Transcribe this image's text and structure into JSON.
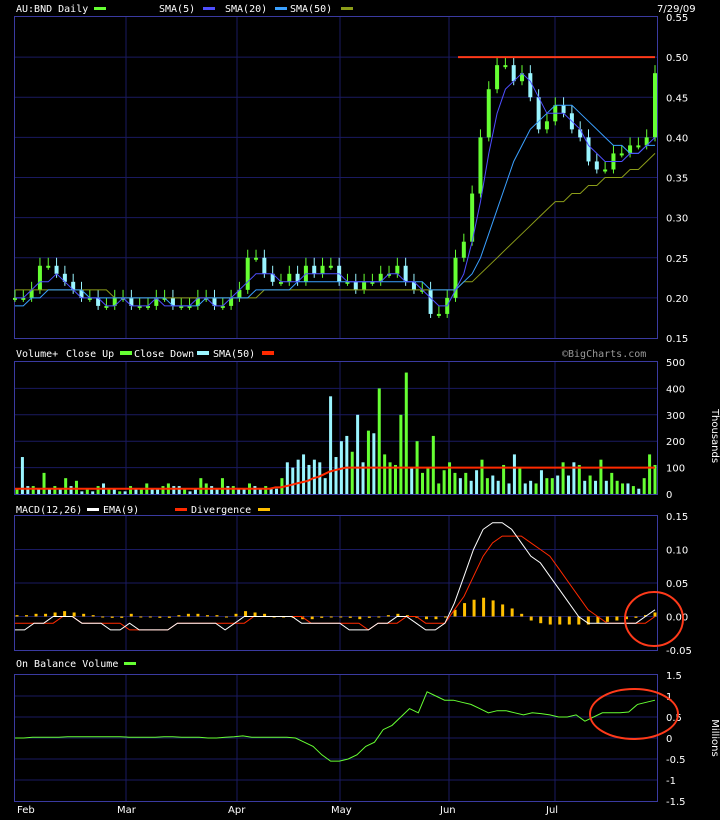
{
  "chart_data": [
    {
      "type": "line",
      "panel": "price",
      "title": "AU:BND Daily",
      "date": "7/29/09",
      "legend": [
        {
          "label": "SMA(5)",
          "color": "#4f4fff"
        },
        {
          "label": "SMA(20)",
          "color": "#3aa0ff"
        },
        {
          "label": "SMA(50)",
          "color": "#8c9d19"
        }
      ],
      "title_swatch_color": "#66ff33",
      "ylim": [
        0.15,
        0.55
      ],
      "yticks": [
        "0.15",
        "0.20",
        "0.25",
        "0.30",
        "0.35",
        "0.40",
        "0.45",
        "0.50",
        "0.55"
      ],
      "xlabels": [
        "Feb",
        "Mar",
        "Apr",
        "May",
        "Jun",
        "Jul"
      ],
      "resistance_level": 0.5,
      "price_points": [
        0.2,
        0.2,
        0.21,
        0.24,
        0.24,
        0.23,
        0.22,
        0.21,
        0.2,
        0.2,
        0.19,
        0.19,
        0.2,
        0.2,
        0.19,
        0.19,
        0.19,
        0.2,
        0.2,
        0.19,
        0.19,
        0.19,
        0.2,
        0.2,
        0.19,
        0.19,
        0.2,
        0.21,
        0.25,
        0.25,
        0.23,
        0.22,
        0.22,
        0.23,
        0.22,
        0.24,
        0.23,
        0.24,
        0.24,
        0.22,
        0.22,
        0.21,
        0.22,
        0.22,
        0.23,
        0.23,
        0.24,
        0.22,
        0.21,
        0.21,
        0.18,
        0.18,
        0.2,
        0.25,
        0.27,
        0.33,
        0.4,
        0.46,
        0.49,
        0.49,
        0.47,
        0.48,
        0.45,
        0.41,
        0.42,
        0.44,
        0.43,
        0.41,
        0.4,
        0.37,
        0.36,
        0.36,
        0.38,
        0.38,
        0.39,
        0.39,
        0.4,
        0.48
      ],
      "sma5_points": [
        0.2,
        0.2,
        0.21,
        0.22,
        0.22,
        0.23,
        0.22,
        0.21,
        0.2,
        0.2,
        0.2,
        0.19,
        0.19,
        0.2,
        0.19,
        0.19,
        0.19,
        0.2,
        0.19,
        0.19,
        0.19,
        0.19,
        0.2,
        0.2,
        0.19,
        0.19,
        0.2,
        0.21,
        0.22,
        0.23,
        0.23,
        0.23,
        0.22,
        0.22,
        0.22,
        0.23,
        0.23,
        0.23,
        0.23,
        0.23,
        0.22,
        0.22,
        0.22,
        0.22,
        0.22,
        0.23,
        0.23,
        0.22,
        0.22,
        0.21,
        0.2,
        0.19,
        0.19,
        0.21,
        0.23,
        0.27,
        0.32,
        0.38,
        0.43,
        0.46,
        0.47,
        0.48,
        0.47,
        0.45,
        0.43,
        0.43,
        0.43,
        0.42,
        0.41,
        0.39,
        0.38,
        0.37,
        0.37,
        0.37,
        0.38,
        0.38,
        0.39,
        0.4
      ],
      "sma20_points": [
        0.19,
        0.19,
        0.2,
        0.2,
        0.21,
        0.21,
        0.21,
        0.21,
        0.21,
        0.2,
        0.2,
        0.2,
        0.2,
        0.2,
        0.2,
        0.2,
        0.2,
        0.2,
        0.2,
        0.19,
        0.19,
        0.19,
        0.19,
        0.2,
        0.2,
        0.2,
        0.2,
        0.2,
        0.2,
        0.21,
        0.21,
        0.21,
        0.21,
        0.21,
        0.22,
        0.22,
        0.22,
        0.22,
        0.22,
        0.22,
        0.22,
        0.22,
        0.22,
        0.22,
        0.22,
        0.22,
        0.22,
        0.22,
        0.22,
        0.22,
        0.21,
        0.21,
        0.21,
        0.21,
        0.22,
        0.23,
        0.25,
        0.28,
        0.31,
        0.34,
        0.37,
        0.39,
        0.41,
        0.42,
        0.43,
        0.44,
        0.44,
        0.44,
        0.43,
        0.42,
        0.41,
        0.4,
        0.39,
        0.39,
        0.38,
        0.38,
        0.39,
        0.39
      ],
      "sma50_points": [
        0.21,
        0.21,
        0.21,
        0.21,
        0.21,
        0.21,
        0.21,
        0.21,
        0.21,
        0.21,
        0.21,
        0.21,
        0.2,
        0.2,
        0.2,
        0.2,
        0.2,
        0.2,
        0.2,
        0.2,
        0.2,
        0.2,
        0.2,
        0.2,
        0.2,
        0.2,
        0.2,
        0.2,
        0.2,
        0.2,
        0.21,
        0.21,
        0.21,
        0.21,
        0.21,
        0.21,
        0.21,
        0.21,
        0.21,
        0.21,
        0.21,
        0.21,
        0.21,
        0.21,
        0.21,
        0.21,
        0.21,
        0.21,
        0.21,
        0.21,
        0.21,
        0.21,
        0.21,
        0.21,
        0.22,
        0.22,
        0.23,
        0.24,
        0.25,
        0.26,
        0.27,
        0.28,
        0.29,
        0.3,
        0.31,
        0.32,
        0.32,
        0.33,
        0.33,
        0.34,
        0.34,
        0.35,
        0.35,
        0.35,
        0.36,
        0.36,
        0.37,
        0.38
      ]
    },
    {
      "type": "bar",
      "panel": "volume",
      "legend_title": "Volume+",
      "legend": [
        {
          "label": "Close Up",
          "color": "#66ff33"
        },
        {
          "label": "Close Down",
          "color": "#9af5ff"
        },
        {
          "label": "SMA(50)",
          "color": "#ff2a00"
        }
      ],
      "watermark": "©BigCharts.com",
      "ylabel": "Thousands",
      "ylim": [
        0,
        500
      ],
      "yticks": [
        "0",
        "100",
        "200",
        "300",
        "400",
        "500"
      ],
      "volumes": [
        20,
        140,
        30,
        30,
        20,
        80,
        20,
        30,
        20,
        60,
        30,
        50,
        10,
        20,
        10,
        30,
        40,
        20,
        20,
        10,
        10,
        30,
        20,
        20,
        40,
        20,
        20,
        30,
        40,
        30,
        30,
        20,
        10,
        20,
        60,
        40,
        30,
        20,
        60,
        30,
        30,
        20,
        20,
        40,
        30,
        20,
        30,
        20,
        20,
        60,
        120,
        100,
        130,
        150,
        110,
        130,
        120,
        60,
        370,
        140,
        200,
        220,
        160,
        300,
        120,
        240,
        230,
        400,
        150,
        120,
        110,
        300,
        460,
        100,
        200,
        80,
        100,
        220,
        40,
        90,
        120,
        80,
        60,
        80,
        50,
        90,
        130,
        60,
        70,
        50,
        110,
        40,
        150,
        100,
        40,
        50,
        40,
        90,
        60,
        60,
        70,
        120,
        70,
        120,
        110,
        50,
        70,
        50,
        130,
        50,
        80,
        50,
        40,
        40,
        30,
        20,
        60,
        150,
        110
      ],
      "up_flags": [
        1,
        0,
        0,
        1,
        0,
        1,
        0,
        1,
        0,
        1,
        0,
        1,
        0,
        1,
        0,
        1,
        0,
        1,
        0,
        1,
        0,
        1,
        0,
        1,
        1,
        0,
        0,
        1,
        1,
        0,
        0,
        1,
        0,
        0,
        1,
        1,
        0,
        0,
        1,
        0,
        1,
        0,
        0,
        1,
        0,
        0,
        1,
        0,
        0,
        1,
        0,
        0,
        0,
        0,
        0,
        0,
        0,
        0,
        0,
        0,
        0,
        0,
        1,
        0,
        0,
        1,
        0,
        1,
        1,
        1,
        1,
        1,
        1,
        0,
        1,
        1,
        1,
        1,
        1,
        1,
        1,
        1,
        0,
        1,
        0,
        0,
        1,
        1,
        0,
        0,
        1,
        0,
        0,
        1,
        0,
        0,
        1,
        0,
        1,
        1,
        0,
        1,
        0,
        0,
        1,
        0,
        1,
        0,
        1,
        0,
        1,
        1,
        1,
        0,
        1,
        0,
        1,
        1,
        1
      ],
      "sma50": [
        20,
        20,
        20,
        20,
        20,
        20,
        20,
        20,
        20,
        20,
        20,
        20,
        20,
        20,
        20,
        20,
        20,
        20,
        20,
        20,
        20,
        20,
        20,
        20,
        20,
        20,
        20,
        20,
        20,
        20,
        20,
        20,
        20,
        20,
        20,
        20,
        20,
        20,
        20,
        20,
        20,
        20,
        20,
        20,
        20,
        20,
        20,
        20,
        25,
        25,
        30,
        35,
        40,
        45,
        50,
        60,
        65,
        75,
        85,
        90,
        95,
        100,
        100,
        100,
        100,
        100,
        100,
        100,
        100,
        100,
        100,
        100,
        100,
        100,
        100,
        100,
        100,
        100,
        100,
        100,
        100,
        100,
        100,
        100,
        100,
        100,
        100,
        100,
        100,
        100,
        100,
        100,
        100,
        100,
        100,
        100,
        100,
        100,
        100,
        100,
        100,
        100,
        100,
        100,
        100,
        100,
        100,
        100,
        100,
        100,
        100,
        100,
        100,
        100,
        100,
        100,
        100,
        100,
        100
      ]
    },
    {
      "type": "line",
      "panel": "macd",
      "legend": [
        {
          "label": "MACD(12,26)",
          "color": "#ffffff"
        },
        {
          "label": "EMA(9)",
          "color": "#ff2a00"
        },
        {
          "label": "Divergence",
          "color": "#ffbf00"
        }
      ],
      "ylim": [
        -0.05,
        0.15
      ],
      "yticks": [
        "-0.05",
        "0.00",
        "0.05",
        "0.10",
        "0.15"
      ],
      "macd_points": [
        -0.02,
        -0.02,
        -0.01,
        -0.01,
        0.0,
        0.0,
        0.0,
        -0.01,
        -0.01,
        -0.01,
        -0.02,
        -0.02,
        -0.01,
        -0.02,
        -0.02,
        -0.02,
        -0.02,
        -0.01,
        -0.01,
        -0.01,
        -0.01,
        -0.01,
        -0.02,
        -0.01,
        0.0,
        0.0,
        0.0,
        0.0,
        0.0,
        0.0,
        -0.01,
        -0.01,
        -0.01,
        -0.01,
        -0.01,
        -0.02,
        -0.02,
        -0.02,
        -0.01,
        -0.01,
        0.0,
        0.0,
        -0.01,
        -0.02,
        -0.02,
        -0.01,
        0.02,
        0.06,
        0.1,
        0.13,
        0.14,
        0.14,
        0.13,
        0.11,
        0.09,
        0.08,
        0.06,
        0.04,
        0.02,
        0.0,
        -0.01,
        -0.01,
        -0.01,
        -0.01,
        -0.01,
        -0.01,
        0.0,
        0.01
      ],
      "ema_points": [
        -0.01,
        -0.01,
        -0.01,
        -0.01,
        -0.01,
        0.0,
        0.0,
        -0.01,
        -0.01,
        -0.01,
        -0.01,
        -0.01,
        -0.02,
        -0.02,
        -0.02,
        -0.02,
        -0.02,
        -0.01,
        -0.01,
        -0.01,
        -0.01,
        -0.01,
        -0.01,
        -0.01,
        -0.01,
        0.0,
        0.0,
        0.0,
        0.0,
        0.0,
        0.0,
        -0.01,
        -0.01,
        -0.01,
        -0.01,
        -0.01,
        -0.01,
        -0.02,
        -0.01,
        -0.01,
        -0.01,
        0.0,
        0.0,
        -0.01,
        -0.01,
        -0.01,
        0.01,
        0.03,
        0.06,
        0.09,
        0.11,
        0.12,
        0.12,
        0.12,
        0.11,
        0.1,
        0.09,
        0.07,
        0.05,
        0.03,
        0.01,
        0.0,
        -0.01,
        -0.01,
        -0.01,
        -0.01,
        -0.01,
        0.0
      ],
      "divergence_points": [
        0.002,
        0.002,
        0.004,
        0.004,
        0.006,
        0.008,
        0.006,
        0.004,
        0.002,
        0.0,
        -0.002,
        -0.002,
        0.004,
        0.0,
        0.0,
        -0.002,
        -0.002,
        0.002,
        0.004,
        0.004,
        0.002,
        0.002,
        0.0,
        0.004,
        0.008,
        0.006,
        0.004,
        0.0,
        0.0,
        -0.002,
        -0.004,
        -0.004,
        -0.002,
        0.0,
        0.0,
        -0.002,
        -0.004,
        -0.002,
        0.0,
        0.002,
        0.004,
        0.002,
        -0.002,
        -0.004,
        -0.004,
        0.0,
        0.01,
        0.02,
        0.025,
        0.028,
        0.024,
        0.018,
        0.012,
        0.004,
        -0.006,
        -0.01,
        -0.012,
        -0.012,
        -0.012,
        -0.012,
        -0.012,
        -0.01,
        -0.008,
        -0.006,
        -0.004,
        -0.002,
        0.002,
        0.006
      ]
    },
    {
      "type": "line",
      "panel": "obv",
      "legend": [
        {
          "label": "On Balance Volume",
          "color": "#66ff33"
        }
      ],
      "ylabel": "Millions",
      "ylim": [
        -1.5,
        1.5
      ],
      "yticks": [
        "-1.5",
        "-1",
        "-0.5",
        "0",
        "0.5",
        "1",
        "1.5"
      ],
      "obv_points": [
        0.0,
        0.0,
        0.02,
        0.02,
        0.02,
        0.02,
        0.03,
        0.03,
        0.03,
        0.03,
        0.03,
        0.03,
        0.03,
        0.02,
        0.02,
        0.02,
        0.02,
        0.03,
        0.03,
        0.02,
        0.02,
        0.02,
        0.0,
        0.0,
        0.02,
        0.03,
        0.05,
        0.02,
        0.02,
        0.02,
        0.02,
        0.02,
        0.0,
        -0.1,
        -0.2,
        -0.4,
        -0.55,
        -0.55,
        -0.5,
        -0.4,
        -0.2,
        -0.1,
        0.2,
        0.3,
        0.5,
        0.7,
        0.6,
        1.1,
        1.0,
        0.9,
        0.9,
        0.85,
        0.8,
        0.7,
        0.6,
        0.65,
        0.65,
        0.6,
        0.55,
        0.6,
        0.58,
        0.55,
        0.5,
        0.5,
        0.55,
        0.4,
        0.5,
        0.6,
        0.6,
        0.6,
        0.62,
        0.8,
        0.85,
        0.9
      ]
    }
  ]
}
